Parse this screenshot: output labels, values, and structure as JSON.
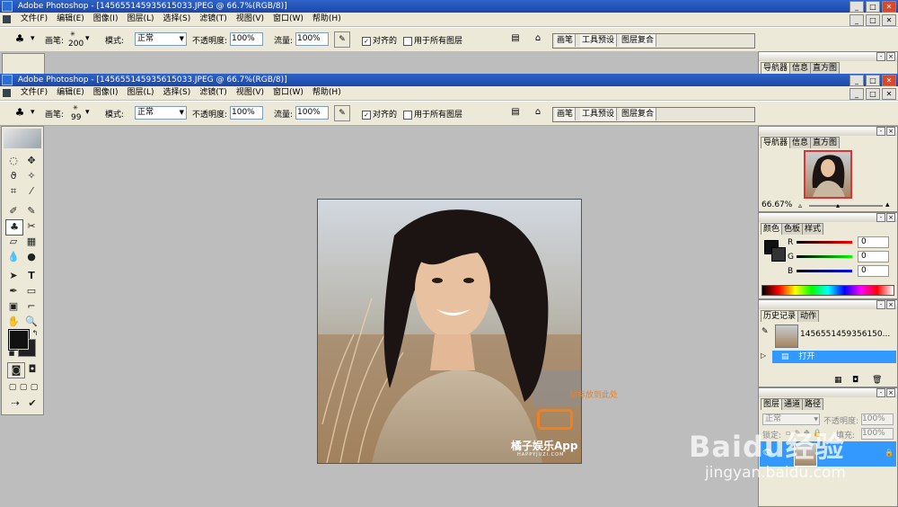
{
  "window": {
    "title": "Adobe Photoshop - [1456551459356150​33.JPEG @ 66.7%(RGB/8)]",
    "title_clean": "Adobe Photoshop - [1456551459356150 33.JPEG @ 66.7%(RGB/8)]"
  },
  "titles": {
    "back": "Adobe Photoshop - [145655145935615033.JPEG @ 66.7%(RGB/8)]",
    "front": "Adobe Photoshop - [145655145935615033.JPEG @ 66.7%(RGB/8)]"
  },
  "menu": [
    "文件(F)",
    "编辑(E)",
    "图像(I)",
    "图层(L)",
    "选择(S)",
    "滤镜(T)",
    "视图(V)",
    "窗口(W)",
    "帮助(H)"
  ],
  "options_back": {
    "brush_label": "画笔:",
    "brush_size": "200",
    "mode_label": "模式:",
    "mode_value": "正常",
    "opacity_label": "不透明度:",
    "opacity_value": "100%",
    "flow_label": "流量:",
    "flow_value": "100%",
    "aligned_label": "对齐的",
    "all_layers_label": "用于所有图层"
  },
  "options_front": {
    "brush_label": "画笔:",
    "brush_size": "99",
    "mode_label": "模式:",
    "mode_value": "正常",
    "opacity_label": "不透明度:",
    "opacity_value": "100%",
    "flow_label": "流量:",
    "flow_value": "100%",
    "aligned_label": "对齐的",
    "all_layers_label": "用于所有图层"
  },
  "palette_well": [
    "画笔",
    "工具预设",
    "图层复合"
  ],
  "navigator": {
    "tabs": [
      "导航器",
      "信息",
      "直方图"
    ],
    "zoom": "66.67%"
  },
  "color_panel": {
    "tabs": [
      "颜色",
      "色板",
      "样式"
    ],
    "channels": [
      {
        "label": "R",
        "value": "0",
        "color": "#c00000"
      },
      {
        "label": "G",
        "value": "0",
        "color": "#00a000"
      },
      {
        "label": "B",
        "value": "0",
        "color": "#0000c0"
      }
    ]
  },
  "history": {
    "tabs": [
      "历史记录",
      "动作"
    ],
    "snapshot_name": "1456551459356150...",
    "step": "打开"
  },
  "layers": {
    "tabs": [
      "图层",
      "通道",
      "路径"
    ],
    "blend_mode": "正常",
    "opacity_label": "不透明度:",
    "opacity_value": "100%",
    "fill_label": "填充:",
    "fill_value": "100%",
    "lock_label": "锁定:"
  },
  "canvas": {
    "annotation": "鼠标放到此处",
    "watermark_title": "橘子娱乐App",
    "watermark_sub": "HAPPYJUZI.COM"
  },
  "baidu": {
    "logo": "Baidu经验",
    "url": "jingyan.baidu.com"
  },
  "colors": {
    "accent_blue": "#3399ff",
    "title_blue": "#2457c4",
    "annotation_orange": "#f08020"
  }
}
